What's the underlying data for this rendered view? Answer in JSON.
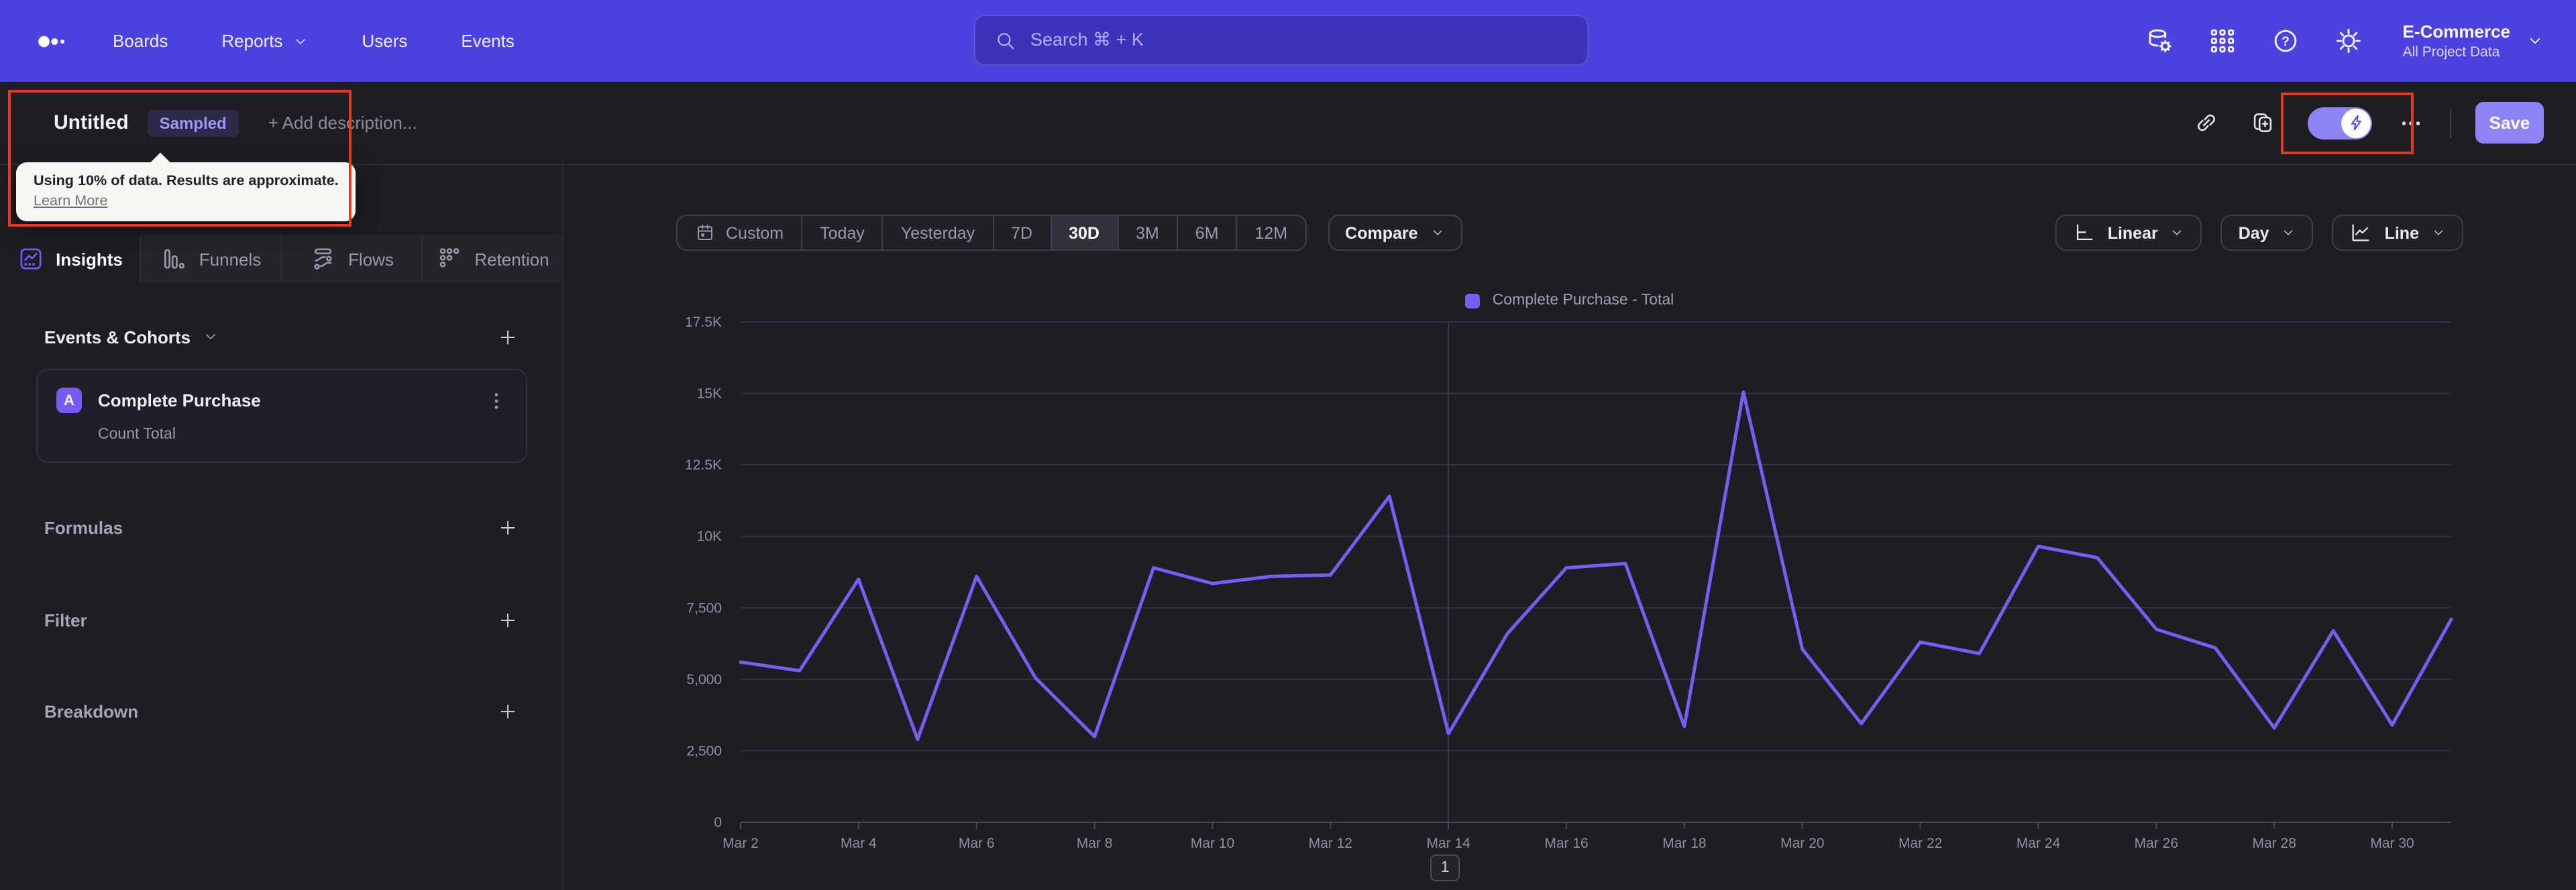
{
  "topnav": {
    "menu": [
      {
        "label": "Boards",
        "has_chevron": false
      },
      {
        "label": "Reports",
        "has_chevron": true
      },
      {
        "label": "Users",
        "has_chevron": false
      },
      {
        "label": "Events",
        "has_chevron": false
      }
    ],
    "search": {
      "placeholder": "Search  ⌘ + K"
    },
    "project": {
      "name": "E-Commerce",
      "scope": "All Project Data"
    }
  },
  "title_bar": {
    "title": "Untitled",
    "badge": "Sampled",
    "description_placeholder": "+ Add description...",
    "save_label": "Save",
    "sampling_toggle_on": true
  },
  "tooltip": {
    "text": "Using 10% of data. Results are approximate.",
    "link": "Learn More"
  },
  "sidebar": {
    "tabs": [
      {
        "label": "Insights",
        "active": true
      },
      {
        "label": "Funnels",
        "active": false
      },
      {
        "label": "Flows",
        "active": false
      },
      {
        "label": "Retention",
        "active": false
      }
    ],
    "events_header": {
      "label": "Events & Cohorts"
    },
    "event_card": {
      "letter": "A",
      "title": "Complete Purchase",
      "subtitle": "Count Total"
    },
    "sections": [
      {
        "label": "Formulas"
      },
      {
        "label": "Filter"
      },
      {
        "label": "Breakdown"
      }
    ]
  },
  "controls": {
    "ranges": [
      {
        "label": "Custom",
        "icon": "calendar",
        "active": false
      },
      {
        "label": "Today",
        "active": false
      },
      {
        "label": "Yesterday",
        "active": false
      },
      {
        "label": "7D",
        "active": false
      },
      {
        "label": "30D",
        "active": true
      },
      {
        "label": "3M",
        "active": false
      },
      {
        "label": "6M",
        "active": false
      },
      {
        "label": "12M",
        "active": false
      }
    ],
    "compare_label": "Compare",
    "views": [
      {
        "label": "Linear",
        "icon": "axis"
      },
      {
        "label": "Day",
        "icon": null
      },
      {
        "label": "Line",
        "icon": "line-chart"
      }
    ]
  },
  "chart_data": {
    "type": "line",
    "title": "Complete Purchase - Total",
    "legend_position": "top-center",
    "grid": "horizontal",
    "ylim": [
      0,
      17500
    ],
    "x_gridline_at": "Mar 14",
    "x_label_every": 2,
    "categories": [
      "Mar 2",
      "Mar 3",
      "Mar 4",
      "Mar 5",
      "Mar 6",
      "Mar 7",
      "Mar 8",
      "Mar 9",
      "Mar 10",
      "Mar 11",
      "Mar 12",
      "Mar 13",
      "Mar 14",
      "Mar 15",
      "Mar 16",
      "Mar 17",
      "Mar 18",
      "Mar 19",
      "Mar 20",
      "Mar 21",
      "Mar 22",
      "Mar 23",
      "Mar 24",
      "Mar 25",
      "Mar 26",
      "Mar 27",
      "Mar 28",
      "Mar 29",
      "Mar 30",
      "Mar 31"
    ],
    "series": [
      {
        "name": "Complete Purchase - Total",
        "color": "#7b5bf5",
        "values": [
          5600,
          5300,
          8500,
          2900,
          8600,
          5050,
          3000,
          8900,
          8350,
          8600,
          8650,
          11400,
          3100,
          6600,
          8900,
          9050,
          3350,
          15050,
          6050,
          3450,
          6300,
          5900,
          9650,
          9250,
          6750,
          6100,
          3300,
          6700,
          3400,
          7100
        ]
      }
    ],
    "y_ticks": [
      {
        "value": 0,
        "label": "0"
      },
      {
        "value": 2500,
        "label": "2,500"
      },
      {
        "value": 5000,
        "label": "5,000"
      },
      {
        "value": 7500,
        "label": "7,500"
      },
      {
        "value": 10000,
        "label": "10K"
      },
      {
        "value": 12500,
        "label": "12.5K"
      },
      {
        "value": 15000,
        "label": "15K"
      },
      {
        "value": 17500,
        "label": "17.5K"
      }
    ]
  },
  "pagination": {
    "page": "1"
  },
  "colors": {
    "accent_nav": "#4b42e0",
    "line": "#7b5bf5",
    "annotation": "#e8391f",
    "save_button": "#8d82f6",
    "toggle_on": "#8d82f6"
  }
}
